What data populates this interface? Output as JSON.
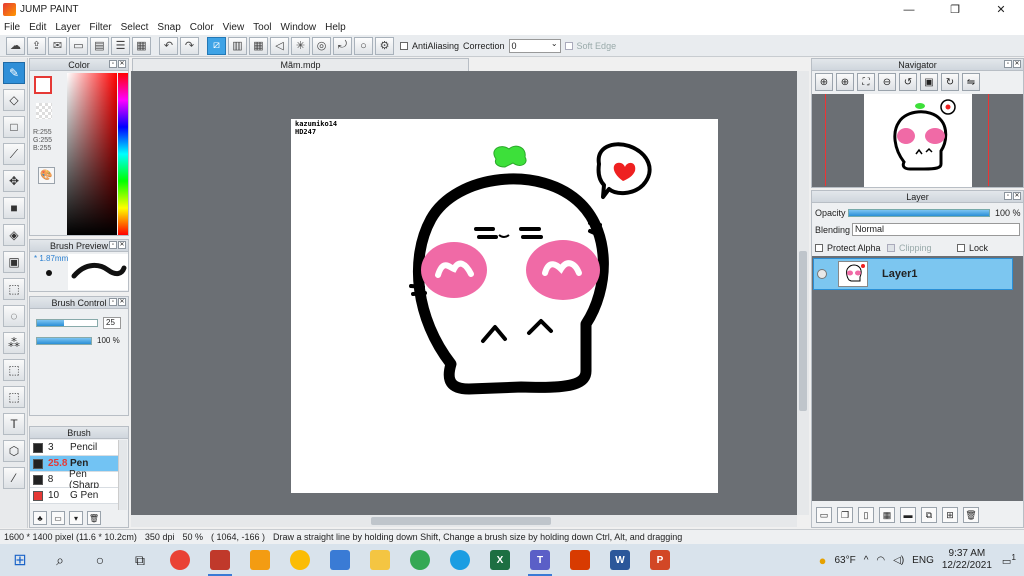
{
  "window": {
    "title": "JUMP PAINT",
    "minimize": "—",
    "maximize": "❐",
    "close": "✕"
  },
  "menu": [
    "File",
    "Edit",
    "Layer",
    "Filter",
    "Select",
    "Snap",
    "Color",
    "View",
    "Tool",
    "Window",
    "Help"
  ],
  "toolbar": {
    "antialiasing_label": "AntiAliasing",
    "correction_label": "Correction",
    "correction_value": "0",
    "soft_edge_label": "Soft Edge"
  },
  "color_panel": {
    "title": "Color",
    "rgb": {
      "r": "R:255",
      "g": "G:255",
      "b": "B:255"
    },
    "foreground": "#ffffff",
    "accent": "#e53935"
  },
  "brush_preview": {
    "title": "Brush Preview",
    "size": "* 1.87mm"
  },
  "brush_control": {
    "title": "Brush Control",
    "size_value": "25",
    "opacity_value": "100 %"
  },
  "brush": {
    "title": "Brush",
    "items": [
      {
        "size": "3",
        "name": "Pencil",
        "color": "#222222"
      },
      {
        "size": "25.8",
        "name": "Pen",
        "color": "#222222"
      },
      {
        "size": "8",
        "name": "Pen (Sharp",
        "color": "#222222"
      },
      {
        "size": "10",
        "name": "G Pen",
        "color": "#e53935"
      }
    ]
  },
  "document": {
    "tab": "Mãm.mdp",
    "signature_line1": "kazumiko14",
    "signature_line2": "HD247"
  },
  "navigator": {
    "title": "Navigator"
  },
  "layer": {
    "title": "Layer",
    "opacity_label": "Opacity",
    "opacity_value": "100 %",
    "blending_label": "Blending",
    "blending_value": "Normal",
    "protect_alpha": "Protect Alpha",
    "clipping": "Clipping",
    "lock": "Lock",
    "layer_name": "Layer1"
  },
  "status": {
    "size": "1600 * 1400 pixel  (11.6 * 10.2cm)",
    "dpi": "350 dpi",
    "zoom": "50 %",
    "coords": "( 1064, -166 )",
    "hint": "Draw a straight line by holding down Shift, Change a brush size by holding down Ctrl, Alt, and dragging"
  },
  "taskbar": {
    "temperature": "63°F",
    "language": "ENG",
    "time": "9:37 AM",
    "date": "12/22/2021",
    "notifications": "1"
  }
}
